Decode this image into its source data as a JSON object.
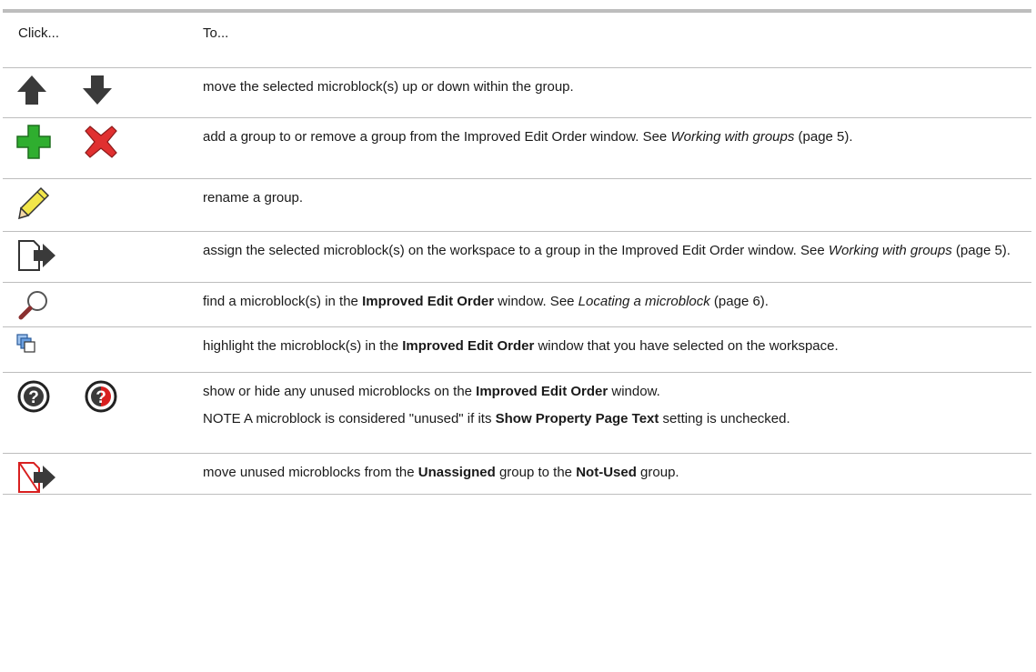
{
  "header": {
    "click": "Click...",
    "to": "To..."
  },
  "rows": [
    {
      "icons": [
        "arrow-up-icon",
        "arrow-down-icon"
      ],
      "text": "move the selected microblock(s) up or down within the group."
    },
    {
      "icons": [
        "add-group-icon",
        "remove-group-icon"
      ],
      "text_a": "add a group to or remove a group from the Improved Edit Order window. See ",
      "link": "Working with groups",
      "text_b": " (page 5)."
    },
    {
      "icons": [
        "pencil-icon"
      ],
      "text": "rename a group."
    },
    {
      "icons": [
        "assign-to-group-icon"
      ],
      "text_a": "assign the selected microblock(s) on the workspace to a group in the Improved Edit Order window. See ",
      "link": "Working with groups",
      "text_b": " (page 5)."
    },
    {
      "icons": [
        "magnifier-icon"
      ],
      "text_a": "find a microblock(s) in the ",
      "bold": "Improved Edit Order",
      "text_b": " window. See ",
      "link": "Locating a microblock",
      "text_c": " (page 6)."
    },
    {
      "icons": [
        "highlight-selected-icon"
      ],
      "text_a": "highlight the microblock(s) in the ",
      "bold": "Improved Edit Order",
      "text_b": " window that you have selected on the workspace."
    },
    {
      "icons": [
        "show-unused-icon",
        "hide-unused-icon"
      ],
      "text_a": "show or hide any unused microblocks on the ",
      "bold": "Improved Edit Order",
      "text_b": " window.",
      "note_a": "NOTE  A microblock is considered \"unused\" if its ",
      "note_bold": "Show Property Page Text",
      "note_b": " setting is unchecked."
    },
    {
      "icons": [
        "move-unused-icon"
      ],
      "text_a": "move unused microblocks from the ",
      "bold_a": "Unassigned",
      "text_b": " group to the ",
      "bold_b": "Not-Used",
      "text_c": " group."
    }
  ],
  "colors": {
    "rule": "#bdbdbd",
    "add_green": "#2fae2f",
    "remove_red": "#e03030",
    "pencil_yellow": "#f2e64a"
  }
}
